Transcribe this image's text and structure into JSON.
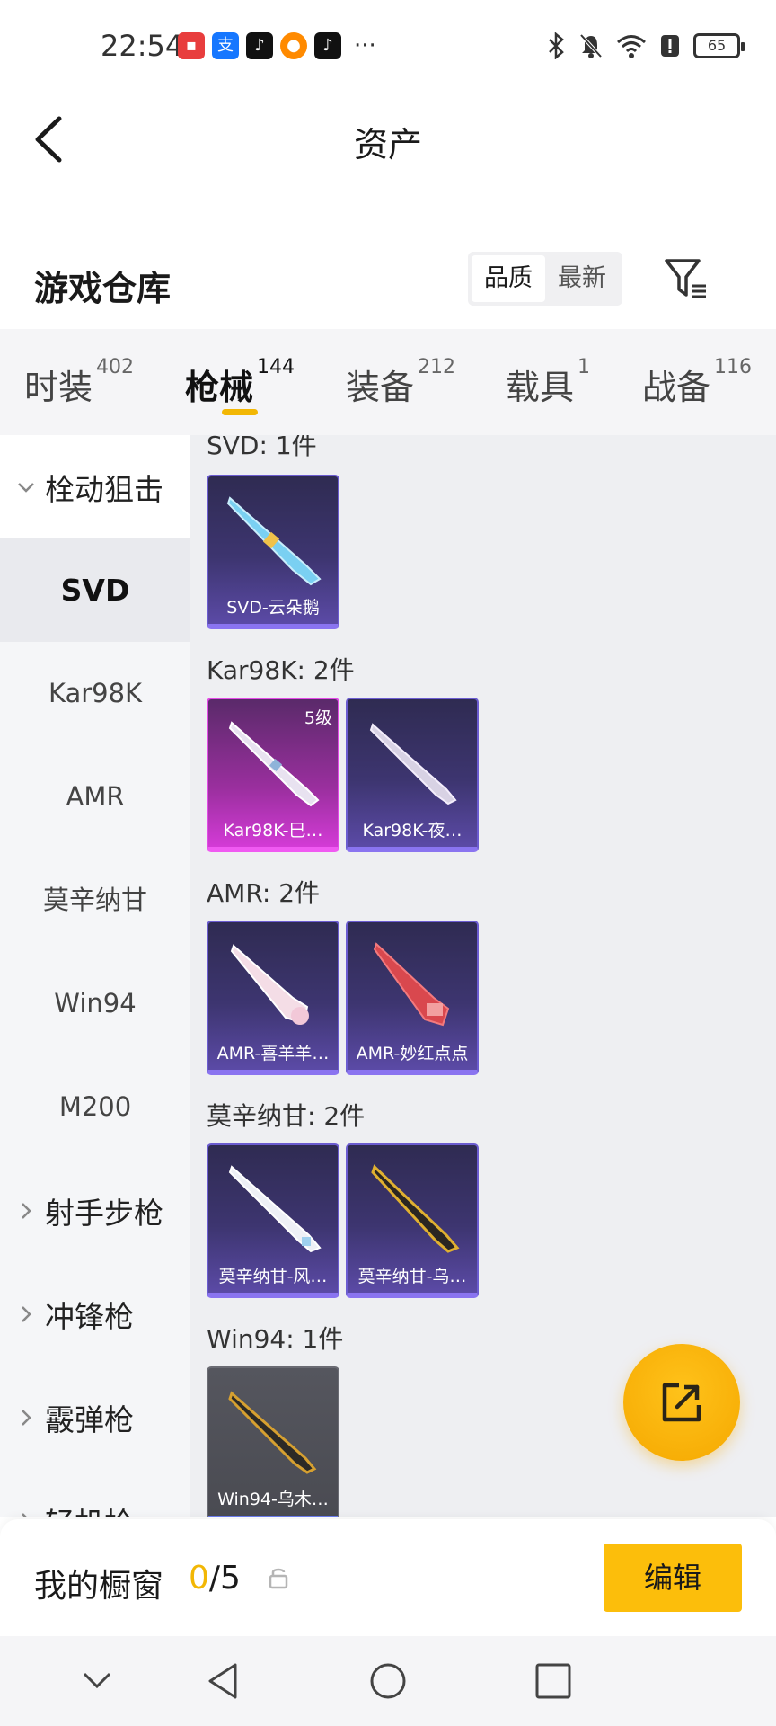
{
  "status_bar": {
    "time": "22:54",
    "more": "···",
    "battery": "65"
  },
  "header": {
    "title": "资产"
  },
  "section": {
    "title": "游戏仓库",
    "sort_options": [
      "品质",
      "最新"
    ],
    "active_sort": "品质"
  },
  "tabs": [
    {
      "label": "时装",
      "count": "402"
    },
    {
      "label": "枪械",
      "count": "144"
    },
    {
      "label": "装备",
      "count": "212"
    },
    {
      "label": "载具",
      "count": "1"
    },
    {
      "label": "战备",
      "count": "116"
    }
  ],
  "sidebar": {
    "groups": [
      {
        "label": "栓动狙击",
        "expanded": true
      },
      {
        "label": "射手步枪",
        "expanded": false
      },
      {
        "label": "冲锋枪",
        "expanded": false
      },
      {
        "label": "霰弹枪",
        "expanded": false
      },
      {
        "label": "轻机枪",
        "expanded": false
      }
    ],
    "items": [
      "SVD",
      "Kar98K",
      "AMR",
      "莫辛纳甘",
      "Win94",
      "M200"
    ],
    "active_item": "SVD"
  },
  "content": {
    "groups": [
      {
        "label": "SVD: 1件",
        "cards": [
          {
            "name": "SVD-云朵鹅",
            "style": "purple",
            "level": ""
          }
        ]
      },
      {
        "label": "Kar98K: 2件",
        "cards": [
          {
            "name": "Kar98K-巳…",
            "style": "pink",
            "level": "5级"
          },
          {
            "name": "Kar98K-夜…",
            "style": "purple",
            "level": ""
          }
        ]
      },
      {
        "label": "AMR: 2件",
        "cards": [
          {
            "name": "AMR-喜羊羊…",
            "style": "purple",
            "level": ""
          },
          {
            "name": "AMR-妙红点点",
            "style": "purple",
            "level": ""
          }
        ]
      },
      {
        "label": "莫辛纳甘: 2件",
        "cards": [
          {
            "name": "莫辛纳甘-风…",
            "style": "purple",
            "level": ""
          },
          {
            "name": "莫辛纳甘-乌…",
            "style": "purple",
            "level": ""
          }
        ]
      },
      {
        "label": "Win94: 1件",
        "cards": [
          {
            "name": "Win94-乌木…",
            "style": "gray",
            "level": ""
          }
        ]
      }
    ]
  },
  "showcase": {
    "label": "我的橱窗",
    "current": "0",
    "total": "/5",
    "edit_label": "编辑"
  },
  "colors": {
    "accent": "#fcbe0b",
    "tab_underline": "#f2b705"
  }
}
